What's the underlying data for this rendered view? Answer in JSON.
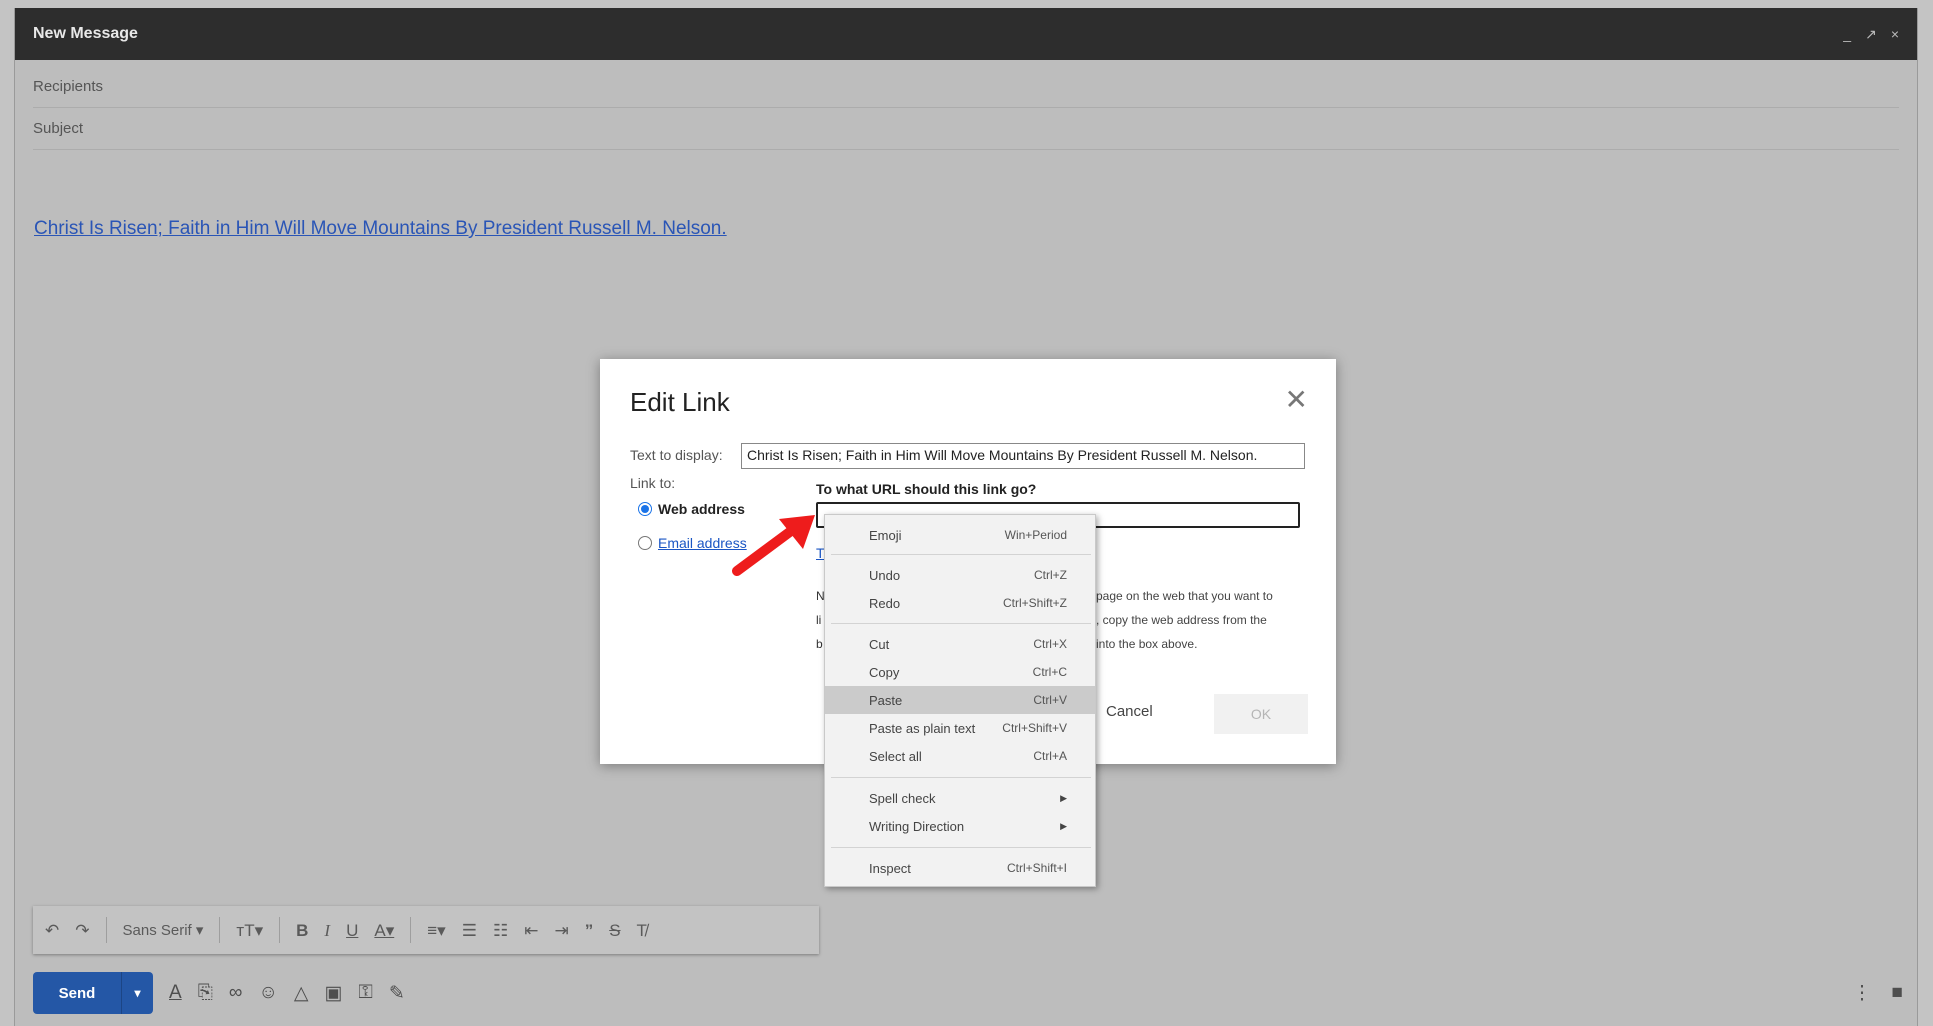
{
  "compose": {
    "title": "New Message",
    "minimize": "_",
    "expand": "↗",
    "close": "×",
    "recipients_placeholder": "Recipients",
    "subject_placeholder": "Subject",
    "body_link_text": "Christ Is Risen; Faith in Him Will Move Mountains By President Russell M. Nelson."
  },
  "toolbar": {
    "font_name": "Sans Serif"
  },
  "sendbar": {
    "send_label": "Send"
  },
  "dialog": {
    "title": "Edit Link",
    "text_to_display_label": "Text to display:",
    "text_to_display_value": "Christ Is Risen; Faith in Him Will Move Mountains By President Russell M. Nelson.",
    "link_to_label": "Link to:",
    "web_address_label": "Web address",
    "email_address_label": "Email address",
    "url_question": "To what URL should this link go?",
    "test_link_partial": "T",
    "note_partial_1": "N",
    "note_partial_2": "li",
    "note_partial_3": "b",
    "note_right_1": "page on the web that you want to",
    "note_right_2": ", copy the web address from the",
    "note_right_3": "into the box above.",
    "cancel_label": "Cancel",
    "ok_label": "OK"
  },
  "context_menu": {
    "items": [
      {
        "label": "Emoji",
        "shortcut": "Win+Period"
      },
      {
        "label": "Undo",
        "shortcut": "Ctrl+Z"
      },
      {
        "label": "Redo",
        "shortcut": "Ctrl+Shift+Z"
      },
      {
        "label": "Cut",
        "shortcut": "Ctrl+X"
      },
      {
        "label": "Copy",
        "shortcut": "Ctrl+C"
      },
      {
        "label": "Paste",
        "shortcut": "Ctrl+V"
      },
      {
        "label": "Paste as plain text",
        "shortcut": "Ctrl+Shift+V"
      },
      {
        "label": "Select all",
        "shortcut": "Ctrl+A"
      },
      {
        "label": "Spell check",
        "shortcut": ""
      },
      {
        "label": "Writing Direction",
        "shortcut": ""
      },
      {
        "label": "Inspect",
        "shortcut": "Ctrl+Shift+I"
      }
    ],
    "highlighted": "Paste"
  },
  "colors": {
    "send_button": "#2457a6",
    "link_blue": "#2a55b6",
    "annotation_arrow": "#ee1c1c",
    "radio_selected": "#1a73e8"
  }
}
